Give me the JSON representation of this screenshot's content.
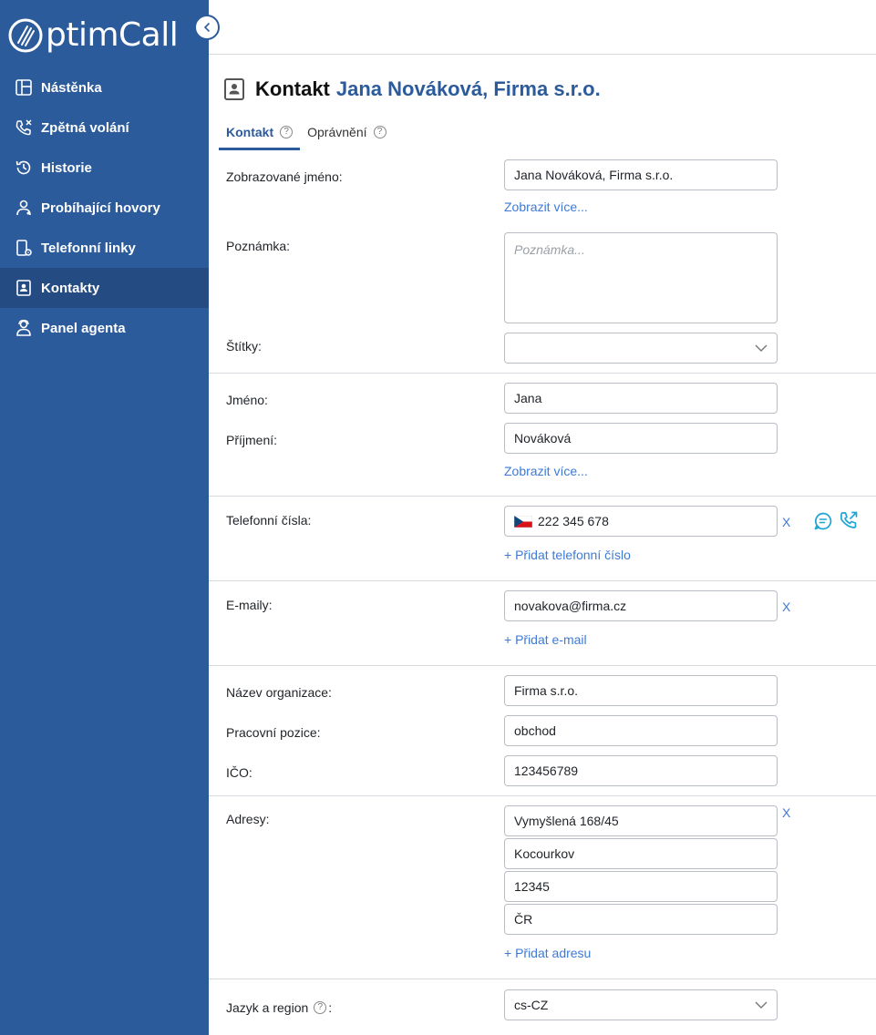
{
  "app": {
    "logo_text": "ptimCall",
    "colors": {
      "sidebar": "#2c5b9c",
      "sidebar_active": "#244b82",
      "link": "#3d7ad6",
      "accent": "#2c5b9c"
    }
  },
  "sidebar": {
    "items": [
      {
        "label": "Nástěnka",
        "icon": "dashboard-icon"
      },
      {
        "label": "Zpětná volání",
        "icon": "callback-icon"
      },
      {
        "label": "Historie",
        "icon": "history-icon"
      },
      {
        "label": "Probíhající hovory",
        "icon": "ongoing-calls-icon"
      },
      {
        "label": "Telefonní linky",
        "icon": "phone-lines-icon"
      },
      {
        "label": "Kontakty",
        "icon": "contacts-icon",
        "active": true
      },
      {
        "label": "Panel agenta",
        "icon": "agent-panel-icon"
      }
    ]
  },
  "page": {
    "title_prefix": "Kontakt",
    "title_name": "Jana Nováková, Firma s.r.o."
  },
  "tabs": [
    {
      "label": "Kontakt",
      "active": true,
      "help": "?"
    },
    {
      "label": "Oprávnění",
      "active": false,
      "help": "?"
    }
  ],
  "form": {
    "display_name": {
      "label": "Zobrazované jméno:",
      "value": "Jana Nováková, Firma s.r.o.",
      "more": "Zobrazit více..."
    },
    "note": {
      "label": "Poznámka:",
      "placeholder": "Poznámka..."
    },
    "tags": {
      "label": "Štítky:",
      "value": ""
    },
    "first_name": {
      "label": "Jméno:",
      "value": "Jana"
    },
    "last_name": {
      "label": "Příjmení:",
      "value": "Nováková",
      "more": "Zobrazit více..."
    },
    "phones": {
      "label": "Telefonní čísla:",
      "value": "222 345 678",
      "flag": "CZ",
      "remove": "X",
      "add": "+ Přidat telefonní číslo"
    },
    "emails": {
      "label": "E-maily:",
      "value": "novakova@firma.cz",
      "remove": "X",
      "add": "+ Přidat e-mail"
    },
    "organization": {
      "label": "Název organizace:",
      "value": "Firma s.r.o."
    },
    "position": {
      "label": "Pracovní pozice:",
      "value": "obchod"
    },
    "ico": {
      "label": "IČO:",
      "value": "123456789"
    },
    "address": {
      "label": "Adresy:",
      "street": "Vymyšlená 168/45",
      "city": "Kocourkov",
      "zip": "12345",
      "country": "ČR",
      "remove": "X",
      "add": "+ Přidat adresu"
    },
    "locale": {
      "label": "Jazyk a region",
      "help": "?",
      "colon": ":",
      "value": "cs-CZ"
    }
  }
}
